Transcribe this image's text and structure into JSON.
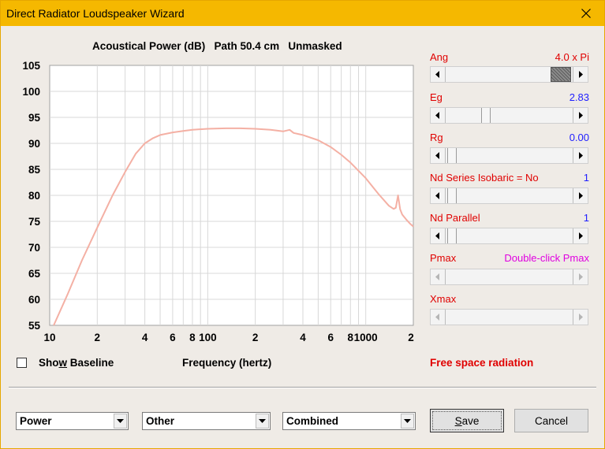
{
  "window": {
    "title": "Direct Radiator Loudspeaker Wizard"
  },
  "chart_title": "Acoustical Power (dB)   Path 50.4 cm   Unmasked",
  "chart_data": {
    "type": "line",
    "title": "Acoustical Power (dB)   Path 50.4 cm   Unmasked",
    "xlabel": "Frequency (hertz)",
    "ylabel": "",
    "x_scale": "log",
    "xlim": [
      10,
      2000
    ],
    "ylim": [
      55,
      105
    ],
    "x_tick_labels": [
      "10",
      "2",
      "4",
      "6",
      "8",
      "100",
      "2",
      "4",
      "6",
      "8",
      "1000",
      "2"
    ],
    "y_tick_labels": [
      "105",
      "100",
      "95",
      "90",
      "85",
      "80",
      "75",
      "70",
      "65",
      "60",
      "55"
    ],
    "grid": true,
    "line_color": "#f4b0a4",
    "series": [
      {
        "x": [
          10.6,
          13,
          16,
          20,
          25,
          30,
          35,
          40,
          45,
          50,
          60,
          70,
          80,
          100,
          130,
          160,
          200,
          250,
          300,
          330,
          350,
          400,
          500,
          600,
          700,
          800,
          1000,
          1200,
          1400,
          1500,
          1550,
          1600,
          1650,
          1700,
          1800,
          1900,
          2000
        ],
        "y": [
          55,
          61,
          67.5,
          73.8,
          80,
          84.5,
          88,
          90,
          91,
          91.6,
          92.1,
          92.4,
          92.6,
          92.8,
          92.9,
          92.9,
          92.8,
          92.6,
          92.3,
          92.6,
          92,
          91.6,
          90.6,
          89.3,
          87.8,
          86.3,
          83.3,
          80.3,
          78,
          77.4,
          77.6,
          80,
          77.3,
          76.3,
          75.4,
          74.6,
          74
        ]
      }
    ]
  },
  "controls": {
    "ang": {
      "label": "Ang",
      "value": "4.0 x Pi"
    },
    "eg": {
      "label": "Eg",
      "value": "2.83"
    },
    "rg": {
      "label": "Rg",
      "value": "0.00"
    },
    "nd_series": {
      "label": "Nd Series   Isobaric = No",
      "value": "1"
    },
    "nd_parallel": {
      "label": "Nd  Parallel",
      "value": "1"
    },
    "pmax": {
      "label": "Pmax",
      "value": "Double-click Pmax"
    },
    "xmax": {
      "label": "Xmax"
    }
  },
  "show_baseline": {
    "label_pre": "Sho",
    "label_mnemonic": "w",
    "label_post": " Baseline",
    "checked": false
  },
  "status_text": "Free space radiation",
  "dropdowns": {
    "mode": "Power",
    "source": "Other",
    "combine": "Combined"
  },
  "buttons": {
    "save_mnemonic": "S",
    "save_rest": "ave",
    "cancel": "Cancel"
  },
  "colors": {
    "title_bar": "#f5b800",
    "label_red": "#e00000",
    "value_blue": "#2020ff",
    "pmax_magenta": "#e000e0",
    "curve": "#f4b0a4"
  }
}
